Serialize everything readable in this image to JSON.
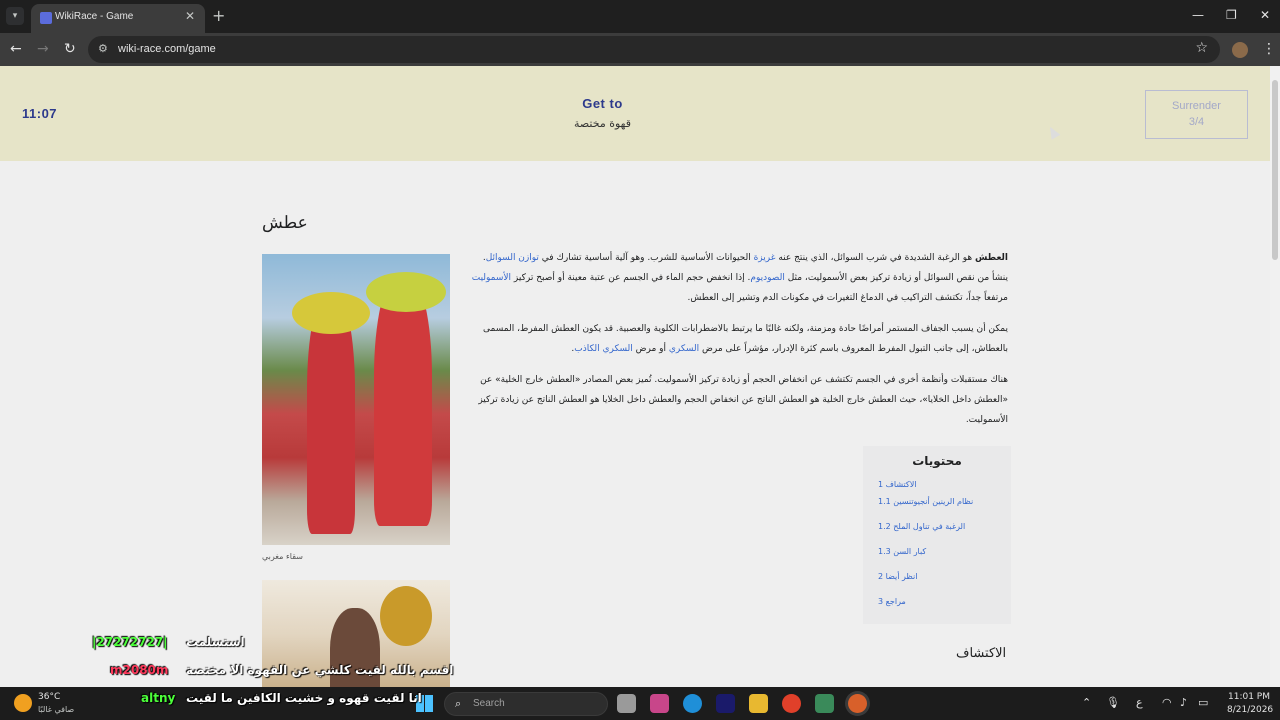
{
  "browser": {
    "tab_title": "WikiRace - Game",
    "url": "wiki-race.com/game"
  },
  "game": {
    "timer": "11:07",
    "goto_label": "Get to",
    "target": "قهوة مختصة",
    "surrender_label": "Surrender",
    "surrender_count": "3/4"
  },
  "article": {
    "title": "عطش",
    "image_caption": "سقاء مغربي",
    "paragraphs": [
      {
        "t1": "العطش",
        "t2": " هو الرغبة الشديدة في شرب السوائل، الذي ينتج عنه ",
        "l1": "غريزة",
        "t3": " الحيوانات الأساسية للشرب. وهو آلية أساسية تشارك في ",
        "l2": "توازن السوائل",
        "t4": ". ينشأ من نقص السوائل أو زيادة تركيز بعض الأسموليت، مثل ",
        "l3": "الصوديوم",
        "t5": ". إذا انخفض حجم الماء في الجسم عن عتبة معينة أو أصبح تركيز ",
        "l4": "الأسموليت",
        "t6": " مرتفعاً جداً، تكتشف التراكيب في الدماغ التغيرات في مكونات الدم وتشير إلى العطش."
      },
      {
        "t1": "يمكن أن يسبب الجفاف المستمر أمراضًا حادة ومزمنة، ولكنه غالبًا ما يرتبط بالاضطرابات الكلوية والعصبية. قد يكون العطش المفرط، المسمى بالعطاش، إلى جانب التبول المفرط المعروف باسم كثرة الإدرار، مؤشراً على مرض ",
        "l1": "السكري",
        "t2": " أو مرض ",
        "l2": "السكري الكاذب",
        "t3": "."
      },
      {
        "t1": "هناك مستقبلات وأنظمة أخرى في الجسم تكتشف عن انخفاض الحجم أو زيادة تركيز الأسموليت. تُميز بعض المصادر «العطش خارج الخلية» عن «العطش داخل الخلايا»، حيث العطش خارج الخلية هو العطش الناتج عن انخفاض الحجم والعطش داخل الخلايا هو العطش الناتج عن زيادة تركيز الأسموليت."
      }
    ],
    "toc": {
      "title": "محتويات",
      "items": [
        "1 الاكتشاف",
        "1.1 نظام الرينين أنجيوتنسين",
        "1.2 الرغبة في تناول الملح",
        "1.3 كبار السن",
        "2 انظر أيضا",
        "3 مراجع"
      ]
    },
    "section_heading": "الاكتشاف"
  },
  "overlay": {
    "line1_user": "استسلمت",
    "line1_msg": "|27272727|",
    "line2_msg": "اقسم بالله لقيت كلشي عن القهوة الا مختصة",
    "line2_user": "m2080m",
    "line3_msg": "انا لقيت قهوه و خشيت الكافين ما لقيت",
    "line3_user": "altny",
    "colors": {
      "green": "#4cff3a",
      "red": "#ff3a5c",
      "white": "#ffffff"
    }
  },
  "taskbar": {
    "temperature": "36°C",
    "weather": "صافي غالبًا",
    "search_placeholder": "Search",
    "language": "ع",
    "time": "11:01 PM",
    "date": "8/21/2026"
  }
}
